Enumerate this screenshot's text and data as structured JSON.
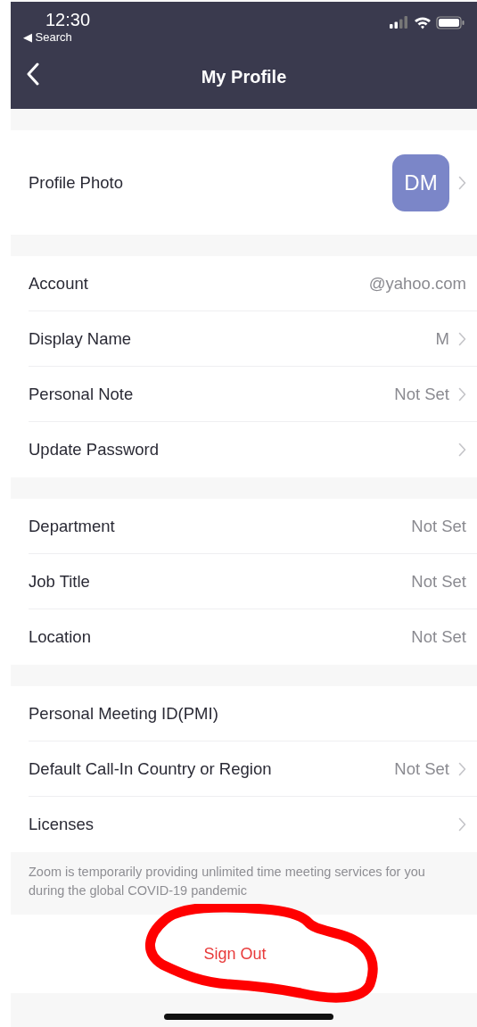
{
  "status_bar": {
    "time": "12:30",
    "back_label": "◀ Search"
  },
  "nav": {
    "title": "My Profile"
  },
  "sections": [
    {
      "rows": [
        {
          "kind": "avatar",
          "label": "Profile Photo",
          "avatar_text": "DM",
          "color": "#7b86c8",
          "chevron": true
        }
      ]
    },
    {
      "rows": [
        {
          "kind": "value",
          "label": "Account",
          "value": "@yahoo.com",
          "chevron": false
        },
        {
          "kind": "value",
          "label": "Display Name",
          "value": "M",
          "chevron": true
        },
        {
          "kind": "value",
          "label": "Personal Note",
          "value": "Not Set",
          "chevron": true
        },
        {
          "kind": "value",
          "label": "Update Password",
          "chevron": true
        }
      ]
    },
    {
      "rows": [
        {
          "kind": "value",
          "label": "Department",
          "value": "Not Set",
          "chevron": false
        },
        {
          "kind": "value",
          "label": "Job Title",
          "value": "Not Set",
          "chevron": false
        },
        {
          "kind": "value",
          "label": "Location",
          "value": "Not Set",
          "chevron": false
        }
      ]
    },
    {
      "rows": [
        {
          "kind": "value",
          "label": "Personal Meeting ID(PMI)",
          "chevron": false
        },
        {
          "kind": "value",
          "label": "Default Call-In Country or Region",
          "value": "Not Set",
          "chevron": true
        },
        {
          "kind": "value",
          "label": "Licenses",
          "chevron": true
        }
      ]
    }
  ],
  "note": "Zoom is temporarily providing unlimited time meeting services for you during the global COVID-19 pandemic",
  "sign_out": "Sign Out"
}
